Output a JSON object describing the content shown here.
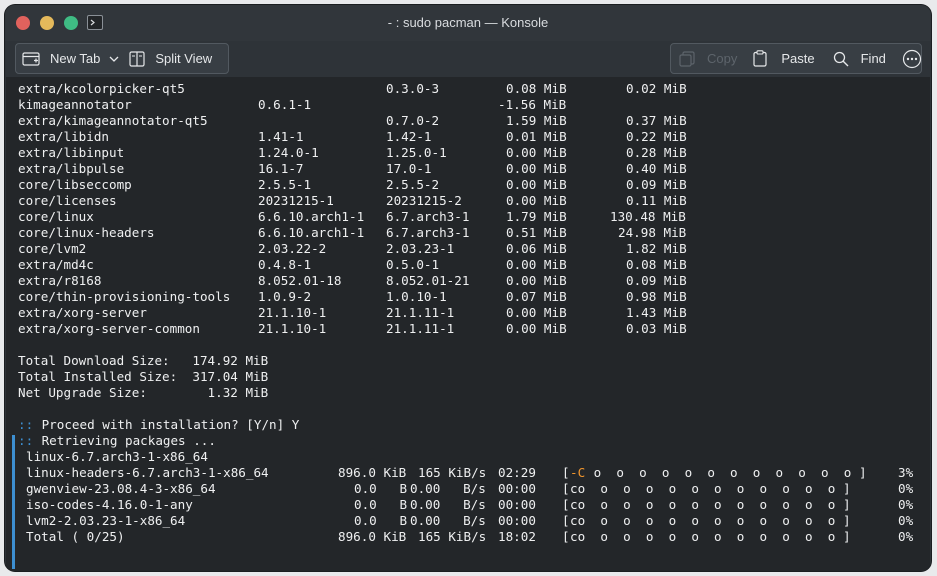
{
  "window": {
    "title": "- : sudo pacman — Konsole"
  },
  "toolbar": {
    "new_tab_label": "New Tab",
    "split_view_label": "Split View",
    "copy_label": "Copy",
    "paste_label": "Paste",
    "find_label": "Find"
  },
  "terminal": {
    "packages": [
      {
        "name": "extra/kcolorpicker-qt5",
        "old": "",
        "new": "0.3.0-3",
        "net": "0.08 MiB",
        "download": "0.02 MiB"
      },
      {
        "name": "kimageannotator",
        "old": "0.6.1-1",
        "new": "",
        "net": "-1.56 MiB",
        "download": ""
      },
      {
        "name": "extra/kimageannotator-qt5",
        "old": "",
        "new": "0.7.0-2",
        "net": "1.59 MiB",
        "download": "0.37 MiB"
      },
      {
        "name": "extra/libidn",
        "old": "1.41-1",
        "new": "1.42-1",
        "net": "0.01 MiB",
        "download": "0.22 MiB"
      },
      {
        "name": "extra/libinput",
        "old": "1.24.0-1",
        "new": "1.25.0-1",
        "net": "0.00 MiB",
        "download": "0.28 MiB"
      },
      {
        "name": "extra/libpulse",
        "old": "16.1-7",
        "new": "17.0-1",
        "net": "0.00 MiB",
        "download": "0.40 MiB"
      },
      {
        "name": "core/libseccomp",
        "old": "2.5.5-1",
        "new": "2.5.5-2",
        "net": "0.00 MiB",
        "download": "0.09 MiB"
      },
      {
        "name": "core/licenses",
        "old": "20231215-1",
        "new": "20231215-2",
        "net": "0.00 MiB",
        "download": "0.11 MiB"
      },
      {
        "name": "core/linux",
        "old": "6.6.10.arch1-1",
        "new": "6.7.arch3-1",
        "net": "1.79 MiB",
        "download": "130.48 MiB"
      },
      {
        "name": "core/linux-headers",
        "old": "6.6.10.arch1-1",
        "new": "6.7.arch3-1",
        "net": "0.51 MiB",
        "download": "24.98 MiB"
      },
      {
        "name": "core/lvm2",
        "old": "2.03.22-2",
        "new": "2.03.23-1",
        "net": "0.06 MiB",
        "download": "1.82 MiB"
      },
      {
        "name": "extra/md4c",
        "old": "0.4.8-1",
        "new": "0.5.0-1",
        "net": "0.00 MiB",
        "download": "0.08 MiB"
      },
      {
        "name": "extra/r8168",
        "old": "8.052.01-18",
        "new": "8.052.01-21",
        "net": "0.00 MiB",
        "download": "0.09 MiB"
      },
      {
        "name": "core/thin-provisioning-tools",
        "old": "1.0.9-2",
        "new": "1.0.10-1",
        "net": "0.07 MiB",
        "download": "0.98 MiB"
      },
      {
        "name": "extra/xorg-server",
        "old": "21.1.10-1",
        "new": "21.1.11-1",
        "net": "0.00 MiB",
        "download": "1.43 MiB"
      },
      {
        "name": "extra/xorg-server-common",
        "old": "21.1.10-1",
        "new": "21.1.11-1",
        "net": "0.00 MiB",
        "download": "0.03 MiB"
      }
    ],
    "totals": [
      "Total Download Size:   174.92 MiB",
      "Total Installed Size:  317.04 MiB",
      "Net Upgrade Size:        1.32 MiB"
    ],
    "prompt": {
      "marker": "::",
      "text": " Proceed with installation? [Y/n] Y"
    },
    "retrieving": {
      "marker": "::",
      "text": " Retrieving packages ..."
    },
    "downloads": [
      {
        "name": "linux-6.7.arch3-1-x86_64",
        "size": "",
        "rate": "",
        "time": "",
        "bar_head": "",
        "bar_rest": "",
        "percent": ""
      },
      {
        "name": "linux-headers-6.7.arch3-1-x86_64",
        "size": "896.0 KiB",
        "rate": "165 KiB/s",
        "time": "02:29",
        "bar_head": "-C",
        "bar_rest": " o  o  o  o  o  o  o  o  o  o  o  o ]",
        "percent": "3%"
      },
      {
        "name": "gwenview-23.08.4-3-x86_64",
        "size": "0.0   B",
        "rate": "0.00   B/s",
        "time": "00:00",
        "bar_head": "",
        "bar_rest": "co  o  o  o  o  o  o  o  o  o  o  o ]",
        "percent": "0%"
      },
      {
        "name": "iso-codes-4.16.0-1-any",
        "size": "0.0   B",
        "rate": "0.00   B/s",
        "time": "00:00",
        "bar_head": "",
        "bar_rest": "co  o  o  o  o  o  o  o  o  o  o  o ]",
        "percent": "0%"
      },
      {
        "name": "lvm2-2.03.23-1-x86_64",
        "size": "0.0   B",
        "rate": "0.00   B/s",
        "time": "00:00",
        "bar_head": "",
        "bar_rest": "co  o  o  o  o  o  o  o  o  o  o  o ]",
        "percent": "0%"
      },
      {
        "name": "Total ( 0/25)",
        "size": "896.0 KiB",
        "rate": "165 KiB/s",
        "time": "18:02",
        "bar_head": "",
        "bar_rest": "co  o  o  o  o  o  o  o  o  o  o  o ]",
        "percent": "0%"
      }
    ]
  },
  "colors": {
    "terminal_bg": "#232629",
    "terminal_fg": "#eff0f1",
    "prompt_marker": "#3d8fd1",
    "progress_head": "#f2962d"
  }
}
